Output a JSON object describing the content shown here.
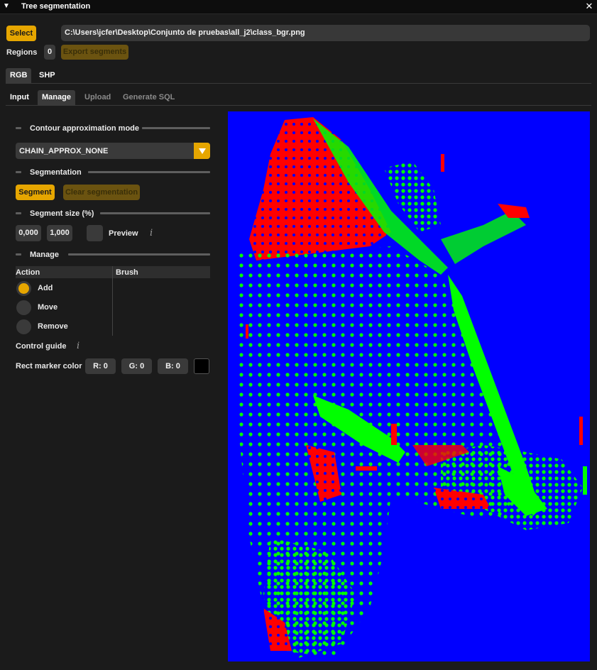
{
  "window": {
    "title": "Tree segmentation",
    "close_glyph": "✕",
    "collapse_glyph": "▼"
  },
  "file": {
    "select_label": "Select",
    "path": "C:\\Users\\jcfer\\Desktop\\Conjunto de pruebas\\all_j2\\class_bgr.png"
  },
  "regions": {
    "label": "Regions",
    "count": "0",
    "export_label": "Export segments"
  },
  "format_tabs": [
    {
      "label": "RGB",
      "active": true
    },
    {
      "label": "SHP",
      "active": false
    }
  ],
  "main_tabs": [
    {
      "label": "Input",
      "state": "plain"
    },
    {
      "label": "Manage",
      "state": "active"
    },
    {
      "label": "Upload",
      "state": "disabled"
    },
    {
      "label": "Generate SQL",
      "state": "disabled"
    }
  ],
  "contour": {
    "header": "Contour approximation mode",
    "value": "CHAIN_APPROX_NONE"
  },
  "segmentation": {
    "header": "Segmentation",
    "segment_label": "Segment",
    "clear_label": "Clear segmentation"
  },
  "segment_size": {
    "header": "Segment size (%)",
    "min": "0,000",
    "max": "1,000",
    "preview_label": "Preview",
    "preview_checked": false
  },
  "manage": {
    "header": "Manage",
    "action_col": "Action",
    "brush_col": "Brush",
    "actions": [
      {
        "label": "Add",
        "selected": true
      },
      {
        "label": "Move",
        "selected": false
      },
      {
        "label": "Remove",
        "selected": false
      }
    ],
    "control_guide": "Control guide",
    "rect_marker_label": "Rect marker color",
    "r": "R:  0",
    "g": "G:  0",
    "b": "B:  0",
    "marker_color": "#000000"
  },
  "image": {
    "background": "#0000ff",
    "class_colors": {
      "tree": "#00ff00",
      "edge": "#ff0000"
    }
  }
}
